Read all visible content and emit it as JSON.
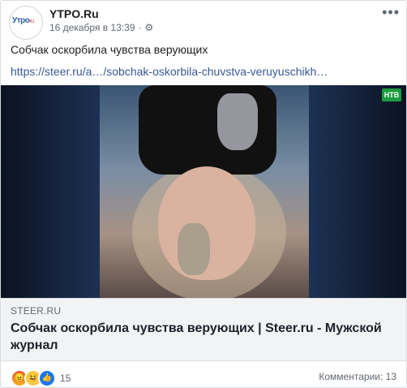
{
  "post": {
    "page_name": "YTPO.Ru",
    "avatar_logo": "Утро",
    "avatar_logo_suffix": "ru",
    "timestamp": "16 декабря в 13:39",
    "text": "Собчак оскорбила чувства верующих",
    "link_text": "https://steer.ru/a…/sobchak-oskorbila-chuvstva-veruyuschikh…"
  },
  "media": {
    "badge": "НТВ",
    "icons": [
      "gear-icon",
      "more-icon"
    ]
  },
  "link_preview": {
    "domain": "STEER.RU",
    "title": "Собчак оскорбила чувства верующих | Steer.ru - Мужской журнал"
  },
  "footer": {
    "reactions": [
      "angry",
      "haha",
      "like"
    ],
    "reaction_count": "15",
    "comments": "Комментарии: 13"
  },
  "colors": {
    "link": "#385898",
    "secondary": "#606770",
    "preview_bg": "#f2f3f5"
  }
}
